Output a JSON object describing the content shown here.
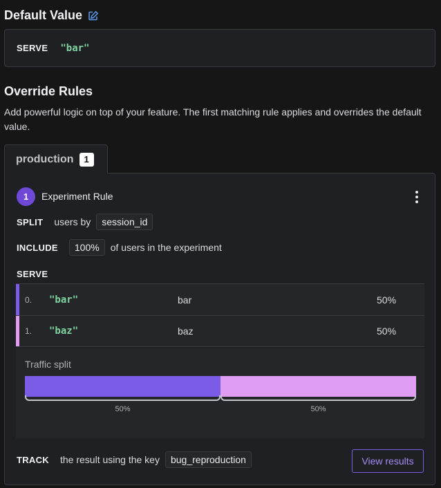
{
  "default_value": {
    "title": "Default Value",
    "icon": "edit-icon",
    "serve_label": "SERVE",
    "value": "\"bar\""
  },
  "override_rules": {
    "title": "Override Rules",
    "description": "Add powerful logic on top of your feature. The first matching rule applies and overrides the default value."
  },
  "env_tab": {
    "label": "production",
    "count": "1"
  },
  "rule": {
    "number": "1",
    "type": "Experiment Rule",
    "menu_icon": "more-vertical-icon",
    "split": {
      "keyword": "SPLIT",
      "prefix": "users by",
      "attribute": "session_id"
    },
    "include": {
      "keyword": "INCLUDE",
      "percent": "100%",
      "suffix": "of users in the experiment"
    },
    "serve_label": "SERVE",
    "variations": [
      {
        "index": "0.",
        "value": "\"bar\"",
        "name": "bar",
        "percent": "50%",
        "color": "#7b5ce6",
        "weight": 0.5
      },
      {
        "index": "1.",
        "value": "\"baz\"",
        "name": "baz",
        "percent": "50%",
        "color": "#e09ef2",
        "weight": 0.5
      }
    ],
    "traffic": {
      "label": "Traffic split",
      "segments": [
        {
          "percent": "50%",
          "weight": 0.5,
          "color": "#7b5ce6"
        },
        {
          "percent": "50%",
          "weight": 0.5,
          "color": "#e09ef2"
        }
      ]
    },
    "track": {
      "keyword": "TRACK",
      "prefix": "the result using the key",
      "key": "bug_reproduction",
      "button_label": "View results"
    }
  }
}
